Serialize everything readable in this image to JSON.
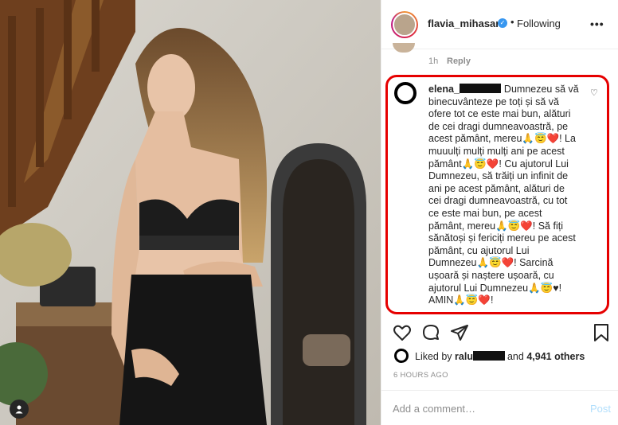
{
  "post": {
    "username": "flavia_mihasan",
    "dot": "•",
    "follow_status": "Following",
    "options": "•••"
  },
  "previous_comment": {
    "time": "1h",
    "reply_label": "Reply"
  },
  "comment": {
    "username": "elena_",
    "text": "Dumnezeu să vă binecuvânteze pe toți și să vă ofere tot ce este mai bun, alături de cei dragi dumneavoastră, pe acest pământ, mereu🙏😇❤️! La muuulți mulți mulți ani pe acest pământ🙏😇❤️! Cu ajutorul Lui Dumnezeu, să trăiți un infinit de ani pe acest pământ, alături de cei dragi dumneavoastră, cu tot ce este mai bun, pe acest pământ, mereu🙏😇❤️! Să fiți sănătoși și fericiți mereu pe acest pământ, cu ajutorul Lui Dumnezeu🙏😇❤️! Sarcină ușoară și naștere ușoară, cu ajutorul Lui Dumnezeu🙏😇♥! AMIN🙏😇❤️!"
  },
  "likes": {
    "prefix": "Liked by",
    "user": "ralu",
    "and": "and",
    "count": "4,941 others"
  },
  "timestamp": "6 HOURS AGO",
  "add_comment": {
    "placeholder": "Add a comment…",
    "post_label": "Post"
  },
  "colors": {
    "highlight": "#e60000",
    "verified": "#3897f0",
    "post_disabled": "#b2dffc"
  },
  "icons": [
    "verified-icon",
    "heart-icon",
    "comment-icon",
    "share-icon",
    "bookmark-icon",
    "user-tag-icon"
  ]
}
